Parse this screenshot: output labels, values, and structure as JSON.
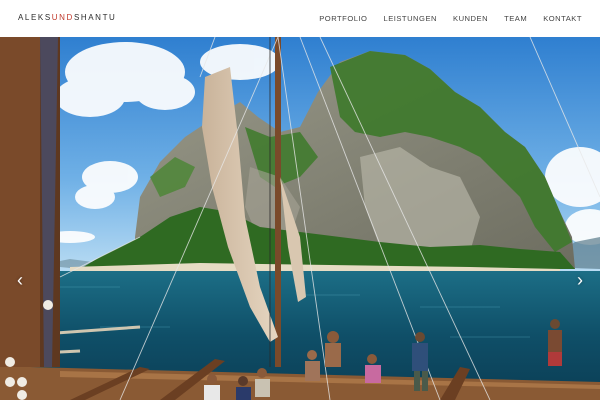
{
  "brand": {
    "part1": "ALEKS",
    "part2": "UND",
    "part3": "SHANTU"
  },
  "nav": {
    "items": [
      "PORTFOLIO",
      "LEISTUNGEN",
      "KUNDEN",
      "TEAM",
      "KONTAKT"
    ]
  },
  "slider": {
    "prev_icon": "‹",
    "next_icon": "›"
  },
  "colors": {
    "accent": "#c0392b",
    "nav_text": "#444444"
  }
}
